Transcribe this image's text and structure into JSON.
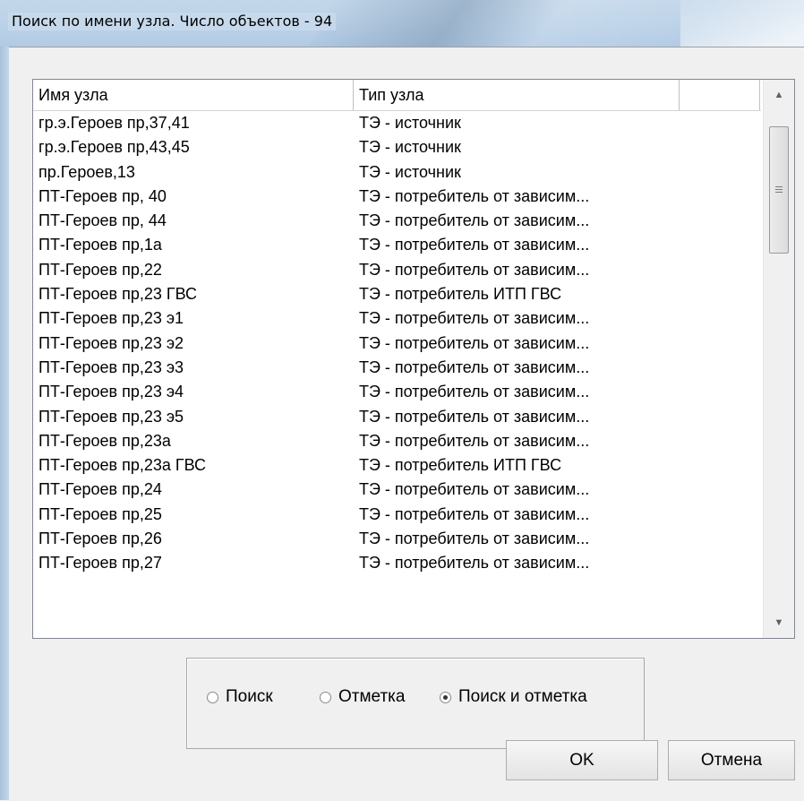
{
  "window": {
    "title": "Поиск по имени узла. Число объектов - 94"
  },
  "list": {
    "columns": [
      "Имя узла",
      "Тип узла",
      ""
    ],
    "rows": [
      {
        "name": "гр.э.Героев пр,37,41",
        "type": "ТЭ - источник"
      },
      {
        "name": "гр.э.Героев пр,43,45",
        "type": "ТЭ - источник"
      },
      {
        "name": "пр.Героев,13",
        "type": "ТЭ - источник"
      },
      {
        "name": "ПТ-Героев пр, 40",
        "type": "ТЭ - потребитель от зависим..."
      },
      {
        "name": "ПТ-Героев пр, 44",
        "type": "ТЭ - потребитель от зависим..."
      },
      {
        "name": "ПТ-Героев пр,1а",
        "type": "ТЭ - потребитель от зависим..."
      },
      {
        "name": "ПТ-Героев пр,22",
        "type": "ТЭ - потребитель от зависим..."
      },
      {
        "name": "ПТ-Героев пр,23 ГВС",
        "type": "ТЭ - потребитель ИТП ГВС"
      },
      {
        "name": "ПТ-Героев пр,23 э1",
        "type": "ТЭ - потребитель от зависим..."
      },
      {
        "name": "ПТ-Героев пр,23 э2",
        "type": "ТЭ - потребитель от зависим..."
      },
      {
        "name": "ПТ-Героев пр,23 э3",
        "type": "ТЭ - потребитель от зависим..."
      },
      {
        "name": "ПТ-Героев пр,23 э4",
        "type": "ТЭ - потребитель от зависим..."
      },
      {
        "name": "ПТ-Героев пр,23 э5",
        "type": "ТЭ - потребитель от зависим..."
      },
      {
        "name": "ПТ-Героев пр,23а",
        "type": "ТЭ - потребитель от зависим..."
      },
      {
        "name": "ПТ-Героев пр,23а ГВС",
        "type": "ТЭ - потребитель ИТП ГВС"
      },
      {
        "name": "ПТ-Героев пр,24",
        "type": "ТЭ - потребитель от зависим..."
      },
      {
        "name": "ПТ-Героев пр,25",
        "type": "ТЭ - потребитель от зависим..."
      },
      {
        "name": "ПТ-Героев пр,26",
        "type": "ТЭ - потребитель от зависим..."
      },
      {
        "name": "ПТ-Героев пр,27",
        "type": "ТЭ - потребитель от зависим..."
      }
    ]
  },
  "mode": {
    "options": [
      "Поиск",
      "Отметка",
      "Поиск и отметка"
    ],
    "selected": "Поиск и отметка"
  },
  "buttons": {
    "ok": "OK",
    "cancel": "Отмена"
  },
  "icons": {
    "scroll_up": "arrow-up-icon",
    "scroll_down": "arrow-down-icon"
  }
}
